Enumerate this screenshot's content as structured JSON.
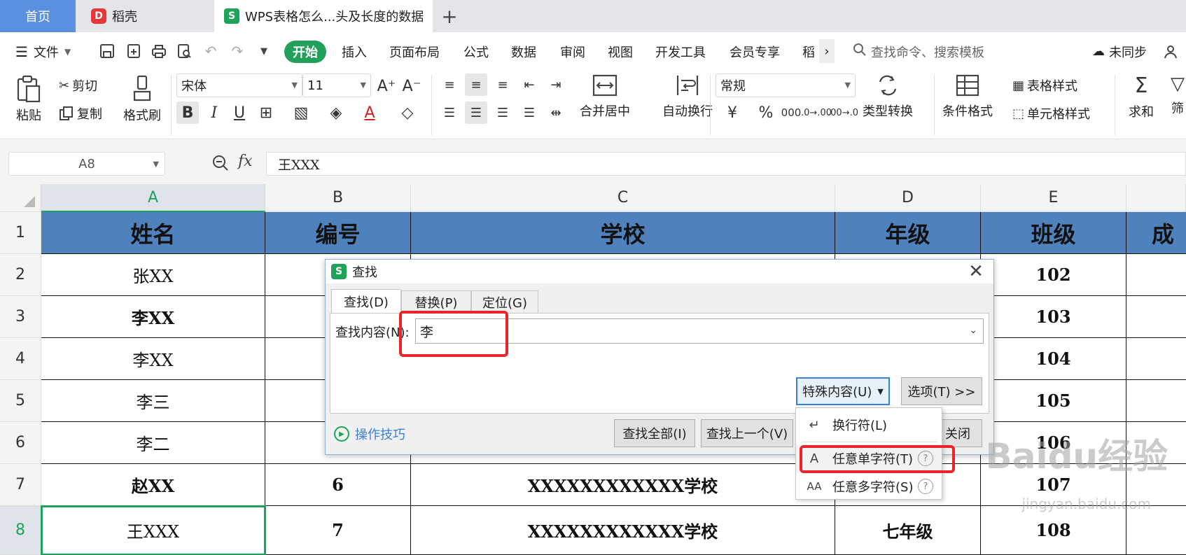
{
  "tabs": {
    "home": "首页",
    "daoke": "稻壳",
    "doc": "WPS表格怎么...头及长度的数据",
    "add": "+"
  },
  "menu": {
    "file": "文件",
    "start": "开始",
    "items": [
      "插入",
      "页面布局",
      "公式",
      "数据",
      "审阅",
      "视图",
      "开发工具",
      "会员专享",
      "稻"
    ],
    "more": "›",
    "search_placeholder": "查找命令、搜索模板",
    "sync": "未同步"
  },
  "ribbon": {
    "paste": "粘贴",
    "cut": "剪切",
    "copy": "复制",
    "format_painter": "格式刷",
    "font_name": "宋体",
    "font_size": "11",
    "merge_center": "合并居中",
    "auto_wrap": "自动换行",
    "number_format": "常规",
    "type_convert": "类型转换",
    "cond_format": "条件格式",
    "table_style": "表格样式",
    "cell_style": "单元格样式",
    "sum": "求和",
    "filter": "筛"
  },
  "formula_bar": {
    "cell_ref": "A8",
    "fx": "fx",
    "content": "王XXX"
  },
  "sheet": {
    "columns": [
      "A",
      "B",
      "C",
      "D",
      "E"
    ],
    "rows": [
      "1",
      "2",
      "3",
      "4",
      "5",
      "6",
      "7",
      "8"
    ],
    "header_row": [
      "姓名",
      "编号",
      "学校",
      "年级",
      "班级",
      "成"
    ],
    "col_a": [
      "张XX",
      "李XX",
      "李XX",
      "李三",
      "李二",
      "赵XX",
      "王XXX"
    ],
    "col_b": [
      "",
      "",
      "",
      "",
      "",
      "6",
      "7"
    ],
    "col_c": [
      "",
      "",
      "",
      "",
      "",
      "XXXXXXXXXXXX学校",
      "XXXXXXXXXXXX学校"
    ],
    "col_d": [
      "",
      "",
      "",
      "",
      "",
      "",
      "七年级"
    ],
    "col_e": [
      "102",
      "103",
      "104",
      "105",
      "106",
      "107",
      "108"
    ]
  },
  "dialog": {
    "title": "查找",
    "close": "✕",
    "tab_find": "查找(D)",
    "tab_replace": "替换(P)",
    "tab_goto": "定位(G)",
    "find_label": "查找内容(N):",
    "find_value": "李",
    "special_btn": "特殊内容(U)",
    "options_btn": "选项(T) >>",
    "tips": "操作技巧",
    "find_all": "查找全部(I)",
    "find_prev": "查找上一个(V)",
    "close_btn": "关闭"
  },
  "dropdown": {
    "items": [
      {
        "glyph": "↵",
        "label": "换行符(L)"
      },
      {
        "glyph": "A",
        "label": "任意单字符(T)",
        "help": "?"
      },
      {
        "glyph": "AA",
        "label": "任意多字符(S)",
        "help": "?"
      }
    ]
  },
  "watermark": {
    "main": "Baidu经验",
    "sub": "jingyan.baidu.com"
  },
  "colors": {
    "accent_green": "#1ea35a",
    "header_blue": "#4f81bd",
    "highlight_red": "#e8262a",
    "home_tab": "#5b8fdf"
  }
}
